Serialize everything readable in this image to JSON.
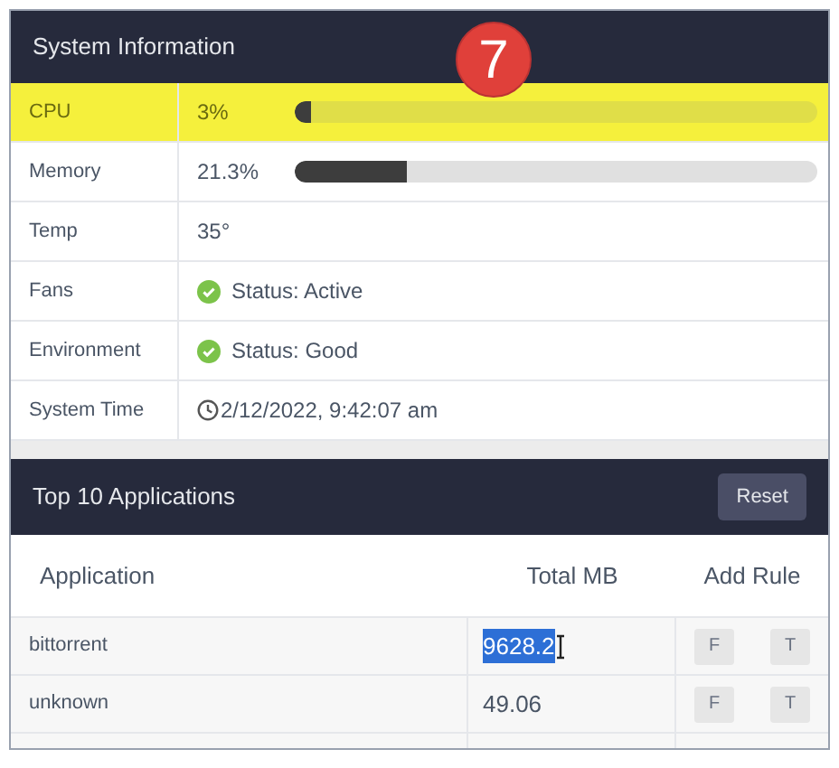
{
  "system_info": {
    "title": "System Information",
    "badge": "7",
    "rows": [
      {
        "kind": "meter",
        "label": "CPU",
        "value": "3%",
        "level": 0.03,
        "highlighted": true
      },
      {
        "kind": "meter",
        "label": "Memory",
        "value": "21.3%",
        "level": 0.213,
        "highlighted": false
      },
      {
        "kind": "text",
        "label": "Temp",
        "value": "35°",
        "highlighted": false
      },
      {
        "kind": "status",
        "label": "Fans",
        "value": "Status: Active",
        "highlighted": false
      },
      {
        "kind": "status",
        "label": "Environment",
        "value": "Status: Good",
        "highlighted": false
      },
      {
        "kind": "time",
        "label": "System Time",
        "value": "2/12/2022, 9:42:07 am",
        "highlighted": false
      }
    ]
  },
  "top_apps": {
    "title": "Top 10 Applications",
    "reset_button": "Reset",
    "columns": [
      "Application",
      "Total MB",
      "Add Rule"
    ],
    "rows": [
      {
        "application": "bittorrent",
        "total_mb": "9628.2",
        "text_selected": true,
        "rule_buttons": [
          "F",
          "T"
        ]
      },
      {
        "application": "unknown",
        "total_mb": "49.06",
        "text_selected": false,
        "rule_buttons": [
          "F",
          "T"
        ]
      }
    ]
  }
}
